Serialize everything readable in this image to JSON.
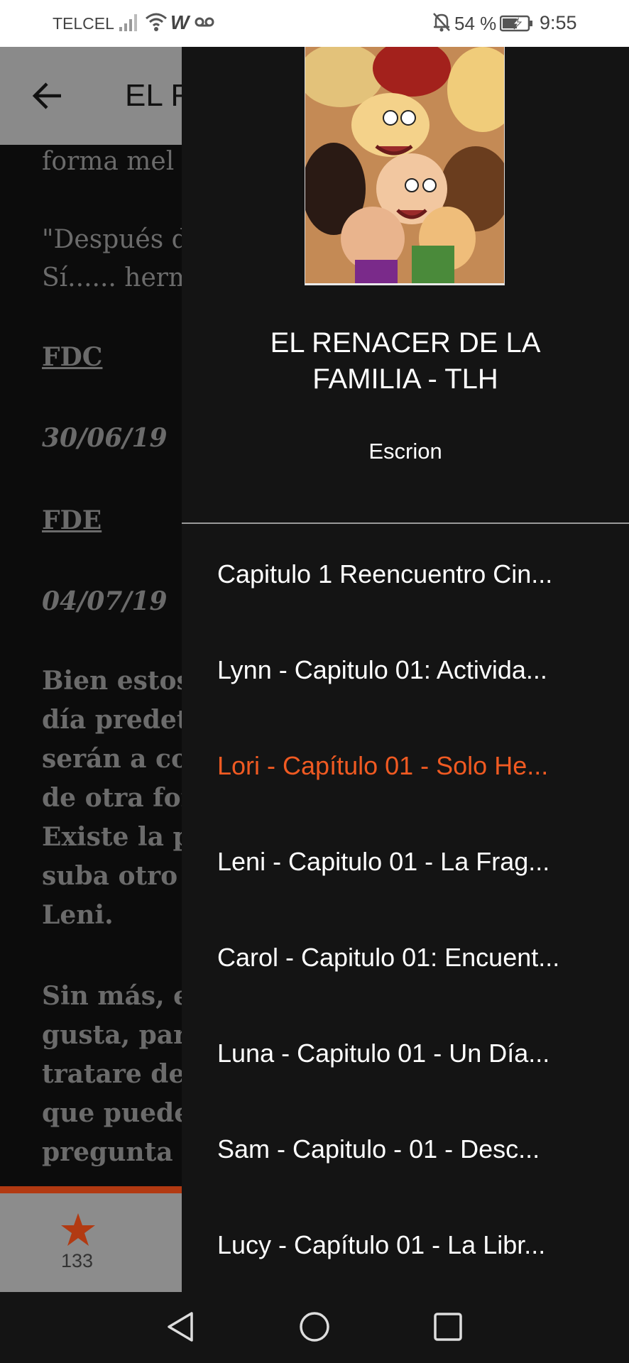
{
  "status_bar": {
    "carrier": "TELCEL",
    "battery_percent": "54 %",
    "time": "9:55",
    "icons": [
      "signal-icon",
      "wifi-icon",
      "w-app-icon",
      "voicemail-icon",
      "bell-off-icon",
      "battery-charging-icon"
    ]
  },
  "reader": {
    "title": "EL R",
    "paragraphs": [
      {
        "text": "forma mel",
        "style": "normal"
      },
      {
        "text": "\"Después d",
        "style": "normal"
      },
      {
        "text": "Sí...... herm",
        "style": "normal"
      },
      {
        "text": "FDC",
        "style": "underline"
      },
      {
        "text": "30/06/19",
        "style": "italic"
      },
      {
        "text": "FDE",
        "style": "underline"
      },
      {
        "text": "04/07/19",
        "style": "italic"
      },
      {
        "text": "Bien estos",
        "style": "bold"
      },
      {
        "text": "día predet",
        "style": "bold"
      },
      {
        "text": "serán a co",
        "style": "bold"
      },
      {
        "text": "de otra for",
        "style": "bold"
      },
      {
        "text": "Existe la p",
        "style": "bold"
      },
      {
        "text": "suba otro",
        "style": "bold"
      },
      {
        "text": "Leni.",
        "style": "bold"
      },
      {
        "text": "Sin más, e",
        "style": "bold"
      },
      {
        "text": "gusta, par",
        "style": "bold"
      },
      {
        "text": "tratare de",
        "style": "bold"
      },
      {
        "text": "que puede",
        "style": "bold"
      },
      {
        "text": "pregunta d",
        "style": "bold"
      }
    ],
    "vote_count": "133"
  },
  "drawer": {
    "story_title_line1": "EL RENACER DE LA",
    "story_title_line2": "FAMILIA - TLH",
    "author": "Escrion",
    "chapters": [
      "Capitulo 1 Reencuentro Cin...",
      "Lynn - Capitulo 01: Activida...",
      "Lori - Capítulo 01 - Solo He...",
      "Leni - Capitulo 01 - La Frag...",
      "Carol - Capitulo 01: Encuent...",
      "Luna - Capitulo 01 - Un Día...",
      "Sam - Capitulo - 01 - Desc...",
      "Lucy - Capítulo 01 - La Libr..."
    ],
    "active_chapter_index": 2
  },
  "colors": {
    "accent": "#f05a22",
    "drawer_bg": "#141414",
    "appbar_dimmed": "#8a8a8a"
  }
}
